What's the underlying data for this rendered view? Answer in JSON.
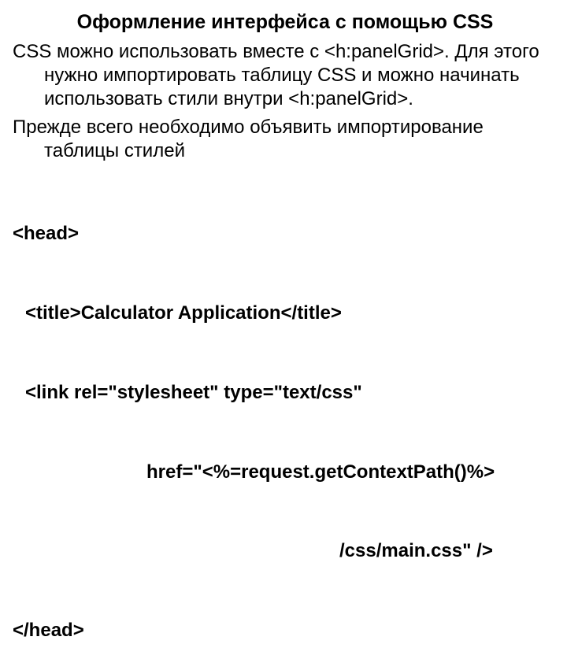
{
  "title": "Оформление интерфейса с помощью CSS",
  "p1": "CSS можно использовать вместе с <h:panelGrid>. Для этого нужно импортировать таблицу CSS и можно начинать использовать стили внутри <h:panelGrid>.",
  "p2": "Прежде всего необходимо объявить импортирование таблицы стилей",
  "code": {
    "l1": "<head>",
    "l2": "<title>Calculator Application</title>",
    "l3": "<link rel=\"stylesheet\" type=\"text/css\"",
    "l4": "href=\"<%=request.getContextPath()%>",
    "l5": "/css/main.css\" />",
    "l6": "</head>"
  }
}
